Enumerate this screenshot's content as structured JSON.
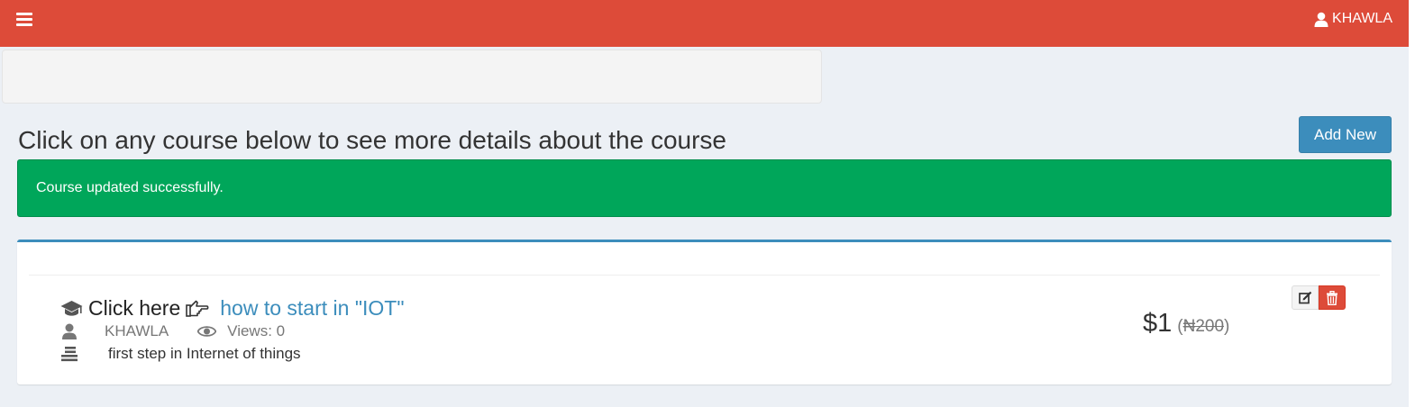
{
  "header": {
    "user_name": "KHAWLA",
    "bg_color": "#dd4b39"
  },
  "page": {
    "heading": "Click on any course below to see more details about the course",
    "add_button_label": "Add New",
    "alert_message": "Course updated successfully."
  },
  "course": {
    "click_here_label": "Click here",
    "title": "how to start in \"IOT\"",
    "author": "KHAWLA",
    "views_label": "Views: 0",
    "description": "first step in Internet of things",
    "price": "$1",
    "old_price": "₦200",
    "old_price_open": "(",
    "old_price_close": ")"
  },
  "icons": {
    "menu": "hamburger-icon",
    "user": "user-icon",
    "graduation": "graduation-cap-icon",
    "hand": "hand-pointer-right-icon",
    "eye": "eye-icon",
    "list": "list-icon",
    "edit": "edit-icon",
    "delete": "trash-icon"
  },
  "colors": {
    "primary": "#3c8dbc",
    "success": "#00a65a",
    "danger": "#dd4b39"
  }
}
